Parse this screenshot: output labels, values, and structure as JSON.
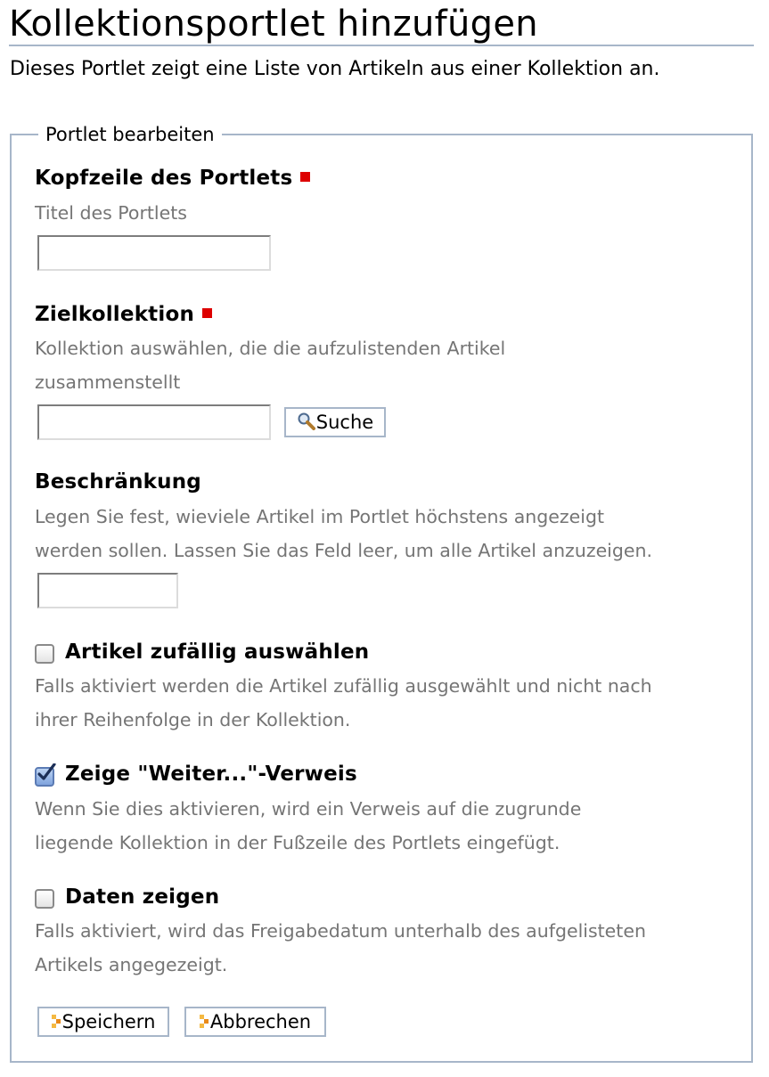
{
  "page": {
    "title": "Kollektionsportlet hinzufügen",
    "description": "Dieses Portlet zeigt eine Liste von Artikeln aus einer Kollektion an."
  },
  "form": {
    "legend": "Portlet bearbeiten",
    "header_field": {
      "label": "Kopfzeile des Portlets",
      "help": "Titel des Portlets",
      "value": ""
    },
    "target_collection": {
      "label": "Zielkollektion",
      "help_line1": "Kollektion auswählen, die die aufzulistenden Artikel",
      "help_line2": "zusammenstellt",
      "value": "",
      "search_button": "Suche"
    },
    "limit": {
      "label": "Beschränkung",
      "help_line1": "Legen Sie fest, wieviele Artikel im Portlet höchstens angezeigt",
      "help_line2": "werden sollen. Lassen Sie das Feld leer, um alle Artikel anzuzeigen.",
      "value": ""
    },
    "random": {
      "label": "Artikel zufällig auswählen",
      "checked": false,
      "help_line1": "Falls aktiviert werden die Artikel zufällig ausgewählt und nicht nach",
      "help_line2": "ihrer Reihenfolge in der Kollektion."
    },
    "show_more": {
      "label": "Zeige \"Weiter...\"-Verweis",
      "checked": true,
      "help_line1": "Wenn Sie dies aktivieren, wird ein Verweis auf die zugrunde",
      "help_line2": "liegende Kollektion in der Fußzeile des Portlets eingefügt."
    },
    "show_dates": {
      "label": "Daten zeigen",
      "checked": false,
      "help_line1": "Falls aktiviert, wird das Freigabedatum unterhalb des aufgelisteten",
      "help_line2": "Artikels angegezeigt."
    },
    "buttons": {
      "save": "Speichern",
      "cancel": "Abbrechen"
    }
  },
  "colors": {
    "required_marker": "#dd0000",
    "border": "#a7b6c9",
    "help_text": "#757575",
    "button_icon": "#f0a030"
  }
}
